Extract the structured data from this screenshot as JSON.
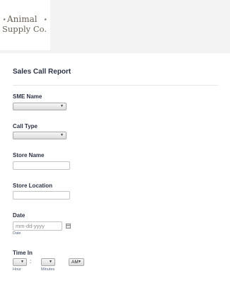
{
  "brand": {
    "logo_line1": "Animal",
    "logo_line2": "Supply Co."
  },
  "form": {
    "title": "Sales Call Report",
    "sme_name_label": "SME Name",
    "call_type_label": "Call Type",
    "store_name_label": "Store Name",
    "store_location_label": "Store Location",
    "date_label": "Date",
    "date_placeholder": "mm-dd-yyyy",
    "date_sublabel": "Date",
    "time_in_label": "Time In",
    "hour_sublabel": "Hour",
    "minutes_sublabel": "Minutes",
    "ampm_value": "AM",
    "time_separator": ":"
  },
  "colors": {
    "header_bg": "#f3f3f3",
    "text": "#2c3345",
    "logo_ink": "#6b6257"
  }
}
